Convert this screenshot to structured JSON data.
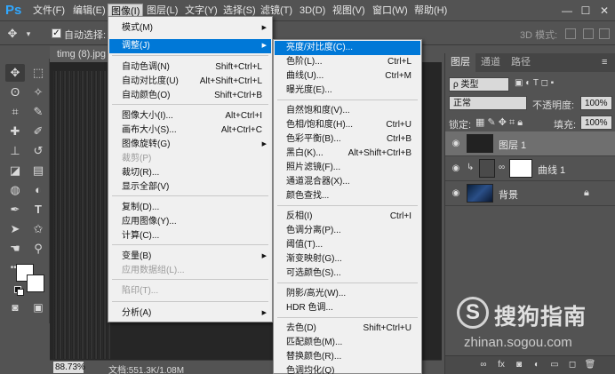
{
  "app": {
    "logo": "Ps",
    "window_controls": [
      "—",
      "☐",
      "✕"
    ]
  },
  "menubar": {
    "items": [
      "文件(F)",
      "编辑(E)",
      "图像(I)",
      "图层(L)",
      "文字(Y)",
      "选择(S)",
      "滤镜(T)",
      "3D(D)",
      "视图(V)",
      "窗口(W)",
      "帮助(H)"
    ],
    "active_index": 2
  },
  "options_bar": {
    "auto_select_label": "自动选择:",
    "auto_select_checked": true,
    "mode_3d_label": "3D 模式:"
  },
  "document": {
    "tab_title": "timg (8).jpg",
    "zoom": "88.73%",
    "doc_info": "文档:551.3K/1.08M"
  },
  "image_menu": {
    "items": [
      {
        "label": "模式(M)",
        "shortcut": "",
        "submenu": true,
        "disabled": false
      },
      {
        "label": "调整(J)",
        "shortcut": "",
        "submenu": true,
        "disabled": false,
        "highlighted": true
      },
      {
        "label": "自动色调(N)",
        "shortcut": "Shift+Ctrl+L",
        "submenu": false,
        "disabled": false
      },
      {
        "label": "自动对比度(U)",
        "shortcut": "Alt+Shift+Ctrl+L",
        "submenu": false,
        "disabled": false
      },
      {
        "label": "自动颜色(O)",
        "shortcut": "Shift+Ctrl+B",
        "submenu": false,
        "disabled": false
      },
      {
        "label": "图像大小(I)...",
        "shortcut": "Alt+Ctrl+I",
        "submenu": false,
        "disabled": false
      },
      {
        "label": "画布大小(S)...",
        "shortcut": "Alt+Ctrl+C",
        "submenu": false,
        "disabled": false
      },
      {
        "label": "图像旋转(G)",
        "shortcut": "",
        "submenu": true,
        "disabled": false
      },
      {
        "label": "裁剪(P)",
        "shortcut": "",
        "submenu": false,
        "disabled": true
      },
      {
        "label": "裁切(R)...",
        "shortcut": "",
        "submenu": false,
        "disabled": false
      },
      {
        "label": "显示全部(V)",
        "shortcut": "",
        "submenu": false,
        "disabled": false
      },
      {
        "label": "复制(D)...",
        "shortcut": "",
        "submenu": false,
        "disabled": false
      },
      {
        "label": "应用图像(Y)...",
        "shortcut": "",
        "submenu": false,
        "disabled": false
      },
      {
        "label": "计算(C)...",
        "shortcut": "",
        "submenu": false,
        "disabled": false
      },
      {
        "label": "变量(B)",
        "shortcut": "",
        "submenu": true,
        "disabled": false
      },
      {
        "label": "应用数据组(L)...",
        "shortcut": "",
        "submenu": false,
        "disabled": true
      },
      {
        "label": "陷印(T)...",
        "shortcut": "",
        "submenu": false,
        "disabled": true
      },
      {
        "label": "分析(A)",
        "shortcut": "",
        "submenu": true,
        "disabled": false
      }
    ]
  },
  "adjust_menu": {
    "items": [
      {
        "label": "亮度/对比度(C)...",
        "shortcut": "",
        "highlighted": true
      },
      {
        "label": "色阶(L)...",
        "shortcut": "Ctrl+L"
      },
      {
        "label": "曲线(U)...",
        "shortcut": "Ctrl+M"
      },
      {
        "label": "曝光度(E)...",
        "shortcut": ""
      },
      {
        "label": "自然饱和度(V)...",
        "shortcut": ""
      },
      {
        "label": "色相/饱和度(H)...",
        "shortcut": "Ctrl+U"
      },
      {
        "label": "色彩平衡(B)...",
        "shortcut": "Ctrl+B"
      },
      {
        "label": "黑白(K)...",
        "shortcut": "Alt+Shift+Ctrl+B"
      },
      {
        "label": "照片滤镜(F)...",
        "shortcut": ""
      },
      {
        "label": "通道混合器(X)...",
        "shortcut": ""
      },
      {
        "label": "颜色查找...",
        "shortcut": ""
      },
      {
        "label": "反相(I)",
        "shortcut": "Ctrl+I"
      },
      {
        "label": "色调分离(P)...",
        "shortcut": ""
      },
      {
        "label": "阈值(T)...",
        "shortcut": ""
      },
      {
        "label": "渐变映射(G)...",
        "shortcut": ""
      },
      {
        "label": "可选颜色(S)...",
        "shortcut": ""
      },
      {
        "label": "阴影/高光(W)...",
        "shortcut": ""
      },
      {
        "label": "HDR 色调...",
        "shortcut": ""
      },
      {
        "label": "去色(D)",
        "shortcut": "Shift+Ctrl+U"
      },
      {
        "label": "匹配颜色(M)...",
        "shortcut": ""
      },
      {
        "label": "替换颜色(R)...",
        "shortcut": ""
      },
      {
        "label": "色调均化(Q)",
        "shortcut": ""
      }
    ]
  },
  "layers_panel": {
    "tabs": [
      "图层",
      "通道",
      "路径"
    ],
    "active_tab": 0,
    "filter_label": "ρ 类型",
    "blend_mode": "正常",
    "opacity_label": "不透明度:",
    "opacity_value": "100%",
    "lock_label": "锁定:",
    "fill_label": "填充:",
    "fill_value": "100%",
    "layers": [
      {
        "name": "图层 1",
        "selected": true
      },
      {
        "name": "曲线 1",
        "selected": false
      },
      {
        "name": "背景",
        "selected": false
      }
    ],
    "footer_icons": [
      "link-icon",
      "fx-icon",
      "mask-icon",
      "adjustment-icon",
      "folder-icon",
      "new-layer-icon",
      "trash-icon"
    ]
  },
  "watermark": {
    "cn_text": "搜狗指南",
    "url": "zhinan.sogou.com"
  }
}
